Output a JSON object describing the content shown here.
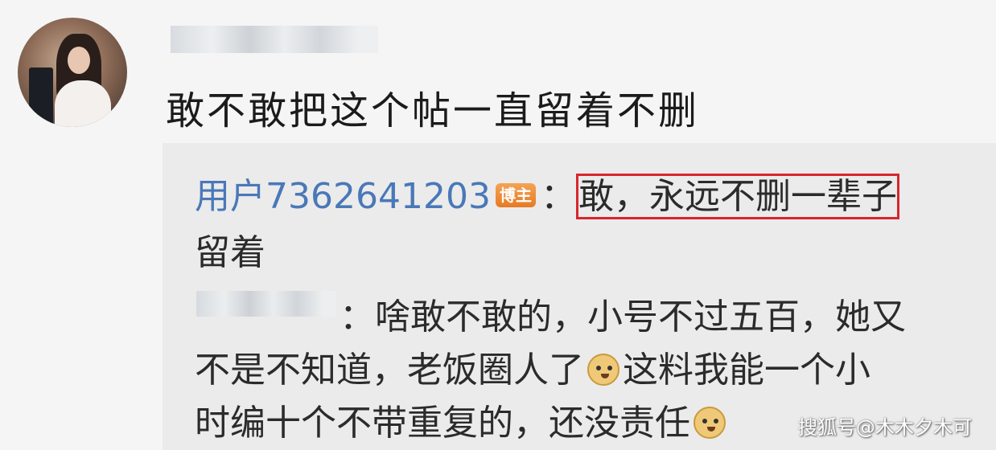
{
  "post": {
    "text": "敢不敢把这个帖一直留着不删"
  },
  "reply1": {
    "username": "用户7362641203",
    "badge": "博主",
    "colon": "：",
    "highlight": "敢，永远不删一辈子",
    "text_line2": "留着"
  },
  "reply2": {
    "colon": "：",
    "line1": "啥敢不敢的，小号不过五百，她又",
    "line2a": "不是不知道，老饭圈人了",
    "line2b": "这料我能一个小",
    "line3": "时编十个不带重复的，还没责任"
  },
  "icons": {
    "avatar": "user-avatar",
    "emoji": "doge-emoji-icon"
  },
  "colors": {
    "username": "#4a78b8",
    "highlight_border": "#d8262d",
    "badge": "#e67a24"
  },
  "watermark": "搜狐号@木木夕木可"
}
